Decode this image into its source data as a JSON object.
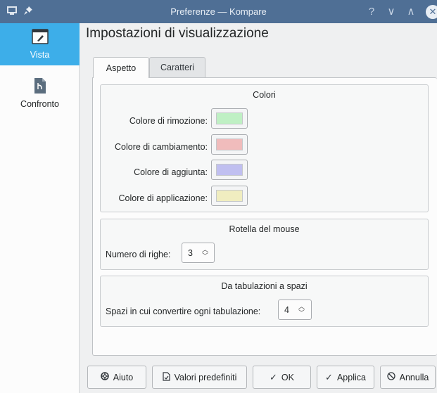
{
  "window": {
    "title": "Preferenze — Kompare",
    "help_glyph": "?",
    "minimize_glyph": "∨",
    "maximize_glyph": "∧",
    "close_glyph": "✕"
  },
  "sidebar": {
    "items": [
      {
        "label": "Vista",
        "icon": "view-brush-icon",
        "active": true
      },
      {
        "label": "Confronto",
        "icon": "diff-file-icon",
        "active": false
      }
    ]
  },
  "page": {
    "title": "Impostazioni di visualizzazione"
  },
  "tabs": [
    {
      "label": "Aspetto",
      "active": true
    },
    {
      "label": "Caratteri",
      "active": false
    }
  ],
  "colors_group": {
    "title": "Colori",
    "rows": [
      {
        "label": "Colore di rimozione:",
        "color": "#bff0c4"
      },
      {
        "label": "Colore di cambiamento:",
        "color": "#f0bcbc"
      },
      {
        "label": "Colore di aggiunta:",
        "color": "#c0bff0"
      },
      {
        "label": "Colore di applicazione:",
        "color": "#f0edc0"
      }
    ]
  },
  "mouse_group": {
    "title": "Rotella del mouse",
    "label": "Numero di righe:",
    "value": "3"
  },
  "tabs_group": {
    "title": "Da tabulazioni a spazi",
    "label": "Spazi in cui convertire ogni tabulazione:",
    "value": "4"
  },
  "buttons": {
    "help": "Aiuto",
    "defaults": "Valori predefiniti",
    "ok": "OK",
    "apply": "Applica",
    "cancel": "Annulla"
  }
}
